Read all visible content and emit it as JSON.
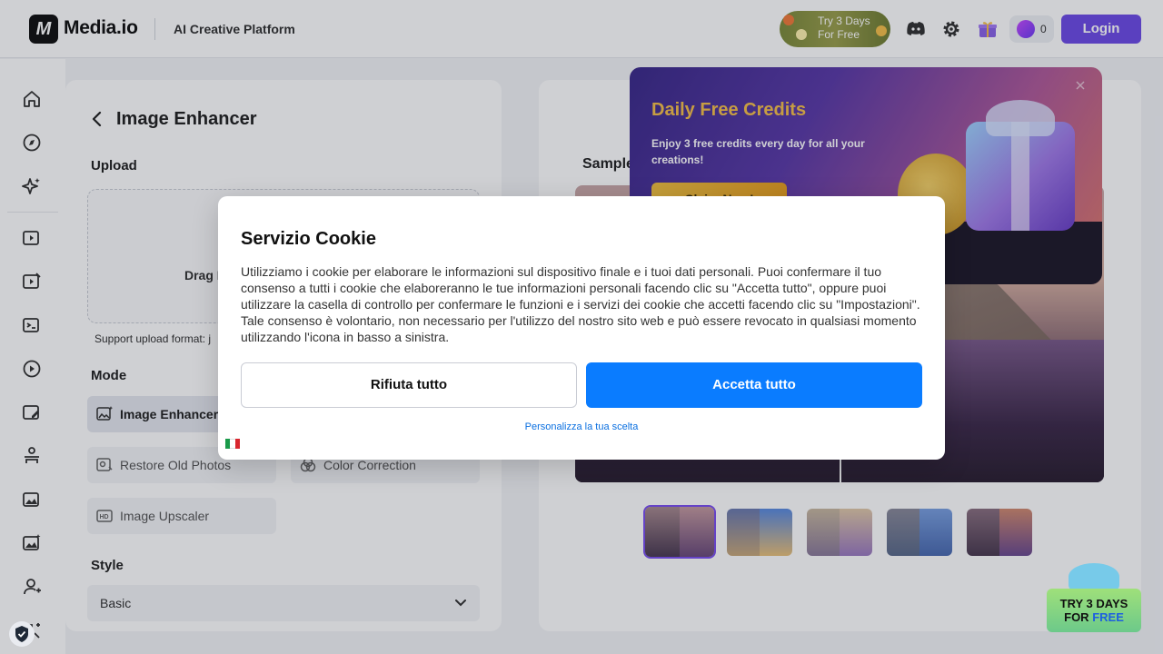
{
  "header": {
    "logo_mark": "M",
    "logo_text": "Media.io",
    "platform": "AI Creative Platform",
    "trial_line1": "Try 3 Days",
    "trial_line2": "For Free",
    "credits": "0",
    "login_label": "Login"
  },
  "sidebar": {
    "icons": [
      "home-icon",
      "compass-icon",
      "sparkle-icon",
      "video-ai-icon",
      "video-edit-icon",
      "video-script-icon",
      "video-play-icon",
      "image-edit-icon",
      "person-swap-icon",
      "image-enhance-icon",
      "image-sparkle-icon",
      "avatar-icon",
      "more-tools-icon"
    ]
  },
  "panel": {
    "title": "Image Enhancer",
    "upload_label": "Upload",
    "upload_hint": "Drag I",
    "support_text": "Support upload format: j",
    "mode_label": "Mode",
    "modes": [
      {
        "label": "Image Enhancer",
        "active": true
      },
      {
        "label": "Restore Old Photos",
        "active": false
      },
      {
        "label": "Color Correction",
        "active": false
      },
      {
        "label": "Image Upscaler",
        "active": false
      }
    ],
    "style_label": "Style",
    "style_value": "Basic"
  },
  "preview": {
    "sample_label": "Sample"
  },
  "promo": {
    "title": "Daily Free Credits",
    "description": "Enjoy 3 free credits every day for all your creations!",
    "button": "Claim Now!"
  },
  "cookie": {
    "title": "Servizio Cookie",
    "text": "Utilizziamo i cookie per elaborare le informazioni sul dispositivo finale e i tuoi dati personali. Puoi confermare il tuo consenso a tutti i cookie che elaboreranno le tue informazioni personali facendo clic su \"Accetta tutto\", oppure puoi utilizzare la casella di controllo per confermare le funzioni e i servizi dei cookie che accetti facendo clic su \"Impostazioni\". Tale consenso è volontario, non necessario per l'utilizzo del nostro sito web e può essere revocato in qualsiasi momento utilizzando l'icona in basso a sinistra.",
    "reject_label": "Rifiuta tutto",
    "accept_label": "Accetta tutto",
    "customize_link": "Personalizza la tua scelta"
  },
  "try_promo": {
    "line1": "TRY 3 DAYS",
    "line2_prefix": "FOR ",
    "line2_highlight": "FREE"
  },
  "colors": {
    "accent": "#6d4ce6",
    "accept_blue": "#0a7cff",
    "promo_gold": "#f5c04a"
  }
}
